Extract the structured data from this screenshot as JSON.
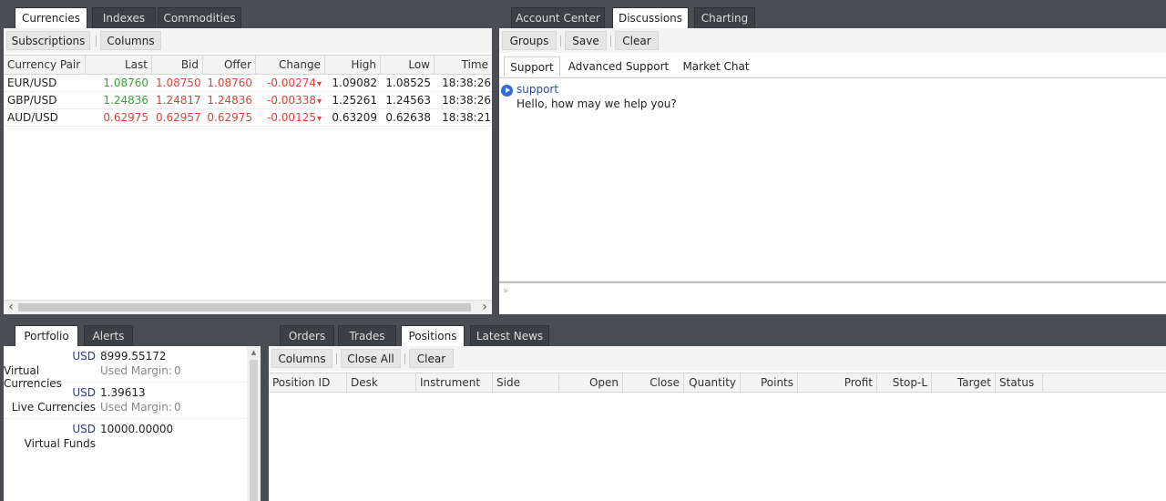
{
  "left_panel": {
    "tabs": [
      "Currencies",
      "Indexes",
      "Commodities"
    ],
    "toolbar": [
      "Subscriptions",
      "Columns"
    ],
    "columns": [
      "Currency Pair",
      "Last",
      "Bid",
      "Offer",
      "Change",
      "High",
      "Low",
      "Time"
    ],
    "rows": [
      {
        "pair": "EUR/USD",
        "last": "1.08760",
        "bid": "1.08750",
        "offer": "1.08760",
        "change": "-0.00274",
        "high": "1.09082",
        "low": "1.08525",
        "time": "18:38:26"
      },
      {
        "pair": "GBP/USD",
        "last": "1.24836",
        "bid": "1.24817",
        "offer": "1.24836",
        "change": "-0.00338",
        "high": "1.25261",
        "low": "1.24563",
        "time": "18:38:26"
      },
      {
        "pair": "AUD/USD",
        "last": "0.62975",
        "bid": "0.62957",
        "offer": "0.62975",
        "change": "-0.00125",
        "high": "0.63209",
        "low": "0.62638",
        "time": "18:38:21"
      }
    ],
    "down_arrow": "▾",
    "scroll_left": "‹",
    "scroll_right": "›"
  },
  "right_panel": {
    "tabs": [
      "Account Center",
      "Discussions",
      "Charting"
    ],
    "toolbar": [
      "Groups",
      "Save",
      "Clear"
    ],
    "subtabs": [
      "Support",
      "Advanced Support",
      "Market Chat"
    ],
    "chat": {
      "sender": "support",
      "message": "Hello, how may we help you?"
    },
    "input_marker": "»"
  },
  "portfolio": {
    "tabs": [
      "Portfolio",
      "Alerts"
    ],
    "items": [
      {
        "currency": "USD",
        "value": "8999.55172",
        "name": "Virtual Currencies",
        "margin_label": "Used Margin:",
        "margin_value": "0"
      },
      {
        "currency": "USD",
        "value": "1.39613",
        "name": "Live Currencies",
        "margin_label": "Used Margin:",
        "margin_value": "0"
      },
      {
        "currency": "USD",
        "value": "10000.00000",
        "name": "Virtual Funds",
        "margin_label": "",
        "margin_value": ""
      }
    ],
    "scroll_up": "▴"
  },
  "positions": {
    "tabs": [
      "Orders",
      "Trades",
      "Positions",
      "Latest News"
    ],
    "toolbar": [
      "Columns",
      "Close All",
      "Clear"
    ],
    "columns": [
      "Position ID",
      "Desk",
      "Instrument",
      "Side",
      "Open",
      "Close",
      "Quantity",
      "Points",
      "Profit",
      "Stop-L",
      "Target",
      "Status"
    ]
  },
  "colors": {
    "background": "#4a4d52",
    "up": "#3aa33a",
    "down": "#d9443b",
    "currency": "#2a3a8a"
  }
}
